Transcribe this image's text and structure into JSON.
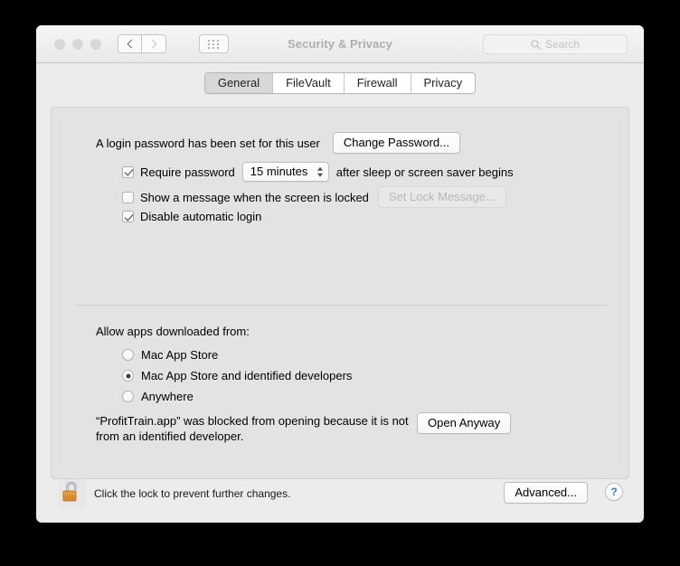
{
  "window": {
    "title": "Security & Privacy",
    "traffic_lights": [
      "close",
      "minimize",
      "maximize"
    ],
    "nav": {
      "back_icon": "chevron-left-icon",
      "forward_icon": "chevron-right-icon",
      "grid_icon": "grid-view-icon"
    },
    "search": {
      "placeholder": "Search",
      "value": "",
      "icon": "search-icon"
    }
  },
  "tabs": [
    {
      "label": "General",
      "selected": true
    },
    {
      "label": "FileVault",
      "selected": false
    },
    {
      "label": "Firewall",
      "selected": false
    },
    {
      "label": "Privacy",
      "selected": false
    }
  ],
  "general": {
    "login_password_text": "A login password has been set for this user",
    "change_password_label": "Change Password...",
    "require_password": {
      "checked": true,
      "label_before": "Require password",
      "interval_value": "15 minutes",
      "label_after": "after sleep or screen saver begins"
    },
    "show_message": {
      "checked": false,
      "label": "Show a message when the screen is locked",
      "button_label": "Set Lock Message...",
      "button_disabled": true
    },
    "disable_automatic_login": {
      "checked": true,
      "label": "Disable automatic login"
    },
    "allow_apps_label": "Allow apps downloaded from:",
    "allow_apps_options": [
      {
        "label": "Mac App Store",
        "selected": false
      },
      {
        "label": "Mac App Store and identified developers",
        "selected": true
      },
      {
        "label": "Anywhere",
        "selected": false
      }
    ],
    "blocked_message": "“ProfitTrain.app” was blocked from opening because it is not from an identified developer.",
    "open_anyway_label": "Open Anyway"
  },
  "footer": {
    "lock_icon": "unlocked-padlock-icon",
    "lock_hint": "Click the lock to prevent further changes.",
    "advanced_label": "Advanced...",
    "help_label": "?"
  },
  "colors": {
    "window_bg": "#ececec",
    "content_bg": "#e3e3e3",
    "accent_help": "#2f7fe0",
    "lock_body": "#e08f2a",
    "title_text": "#aeaeae"
  }
}
